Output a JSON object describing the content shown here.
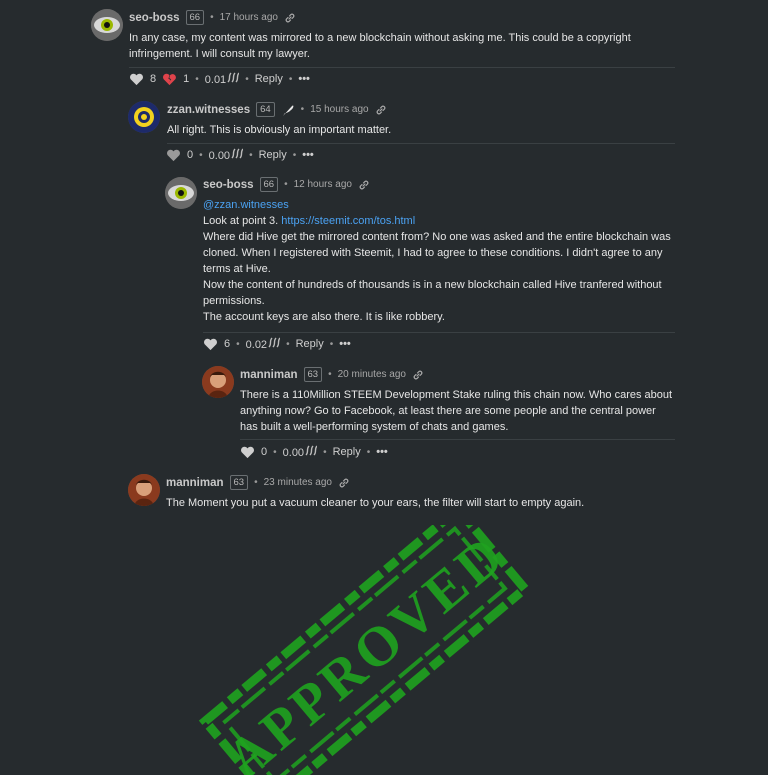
{
  "comments": [
    {
      "author": "seo-boss",
      "rep": "66",
      "time": "17 hours ago",
      "lines": [
        "In any case, my content was mirrored to a new blockchain without asking me. This could be a copyright infringement. I will consult my lawyer."
      ],
      "upvotes": "8",
      "downvotes": "1",
      "payout": "0.01",
      "reply": "Reply",
      "more": "•••"
    },
    {
      "author": "zzan.witnesses",
      "rep": "64",
      "time": "15 hours ago",
      "lines": [
        "All right. This is obviously an important matter."
      ],
      "upvotes": "0",
      "payout": "0.00",
      "reply": "Reply",
      "more": "•••"
    },
    {
      "author": "seo-boss",
      "rep": "66",
      "time": "12 hours ago",
      "mention": "@zzan.witnesses",
      "point_prefix": "Look at point 3. ",
      "point_link": "https://steemit.com/tos.html",
      "lines": [
        "Where did Hive get the mirrored content from? No one was asked and the entire blockchain was cloned. When I registered with Steemit, I had to agree to these conditions. I didn't agree to any terms at Hive.",
        "Now the content of hundreds of thousands is in a new blockchain called Hive tranfered without permissions.",
        "The account keys are also there. It is like robbery."
      ],
      "upvotes": "6",
      "payout": "0.02",
      "reply": "Reply",
      "more": "•••"
    },
    {
      "author": "manniman",
      "rep": "63",
      "time": "20 minutes ago",
      "lines": [
        "There is a 110Million STEEM Development Stake ruling this chain now. Who cares about anything now? Go to Facebook, at least there are some people and the central power has built a well-performing system of chats and games."
      ],
      "upvotes": "0",
      "payout": "0.00",
      "reply": "Reply",
      "more": "•••"
    },
    {
      "author": "manniman",
      "rep": "63",
      "time": "23 minutes ago",
      "lines": [
        "The Moment you put a vacuum cleaner to your ears, the filter will start to empty again."
      ]
    }
  ],
  "separator": "•",
  "stamp": {
    "text": "APPROVED",
    "color": "#1fa31f"
  },
  "colors": {
    "background": "#262b2e",
    "link": "#4ba2f2",
    "downvote": "#e0434b",
    "text": "#e6e6e6"
  }
}
